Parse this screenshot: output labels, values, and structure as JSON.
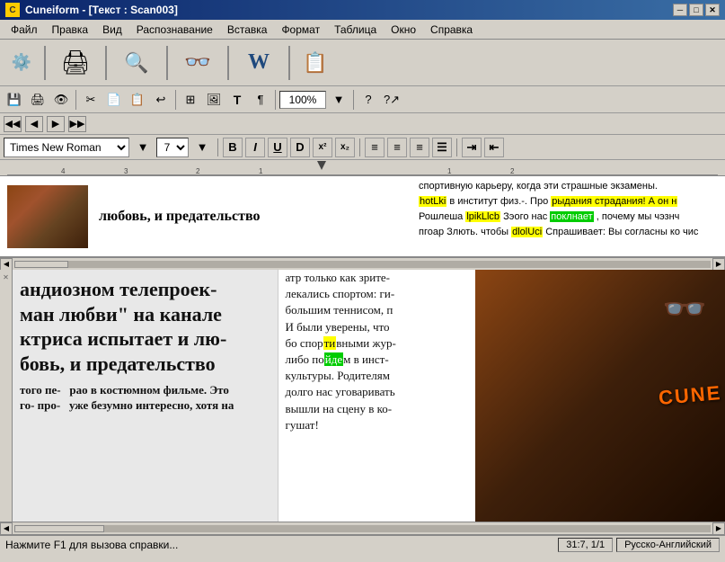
{
  "titleBar": {
    "icon": "C",
    "title": "Cuneiform - [Текст : Scan003]",
    "minBtn": "─",
    "maxBtn": "□",
    "closeBtn": "✕"
  },
  "menuBar": {
    "items": [
      "Файл",
      "Правка",
      "Вид",
      "Распознавание",
      "Вставка",
      "Формат",
      "Таблица",
      "Окно",
      "Справка"
    ]
  },
  "toolbar": {
    "buttons": [
      "🔧",
      "📄",
      "🖨",
      "🔍",
      "📖",
      "W",
      "📋"
    ]
  },
  "toolbar2": {
    "saveIcon": "💾",
    "printIcon": "🖨",
    "zoom": "100%"
  },
  "navBar": {
    "prevFirst": "◀◀",
    "prev": "◀",
    "next": "▶",
    "nextLast": "▶▶"
  },
  "formatBar": {
    "font": "Times New Roman",
    "size": "7",
    "bold": "B",
    "italic": "I",
    "underline": "U",
    "strikethrough": "D",
    "superscript": "x²",
    "subscript": "x₂",
    "alignLeft": "≡",
    "alignCenter": "≡",
    "alignRight": "≡",
    "justify": "≡",
    "indent": "⇤",
    "outdent": "⇥"
  },
  "previewText": {
    "mainText": "любовь, и предательство",
    "rightCol": {
      "line1": "спортивную карьеру, когда эти страшные экзамены.",
      "line2": "hotLki в институт физ.-. Про рыдания страдания! А он н",
      "line3": "Рошлеша lpikLlcb Зэого нас поклнает, почему мы чэзнч",
      "line4": "пгоар Злють. чтобы dlolUci Спрашивает: Вы согласны ко чис"
    }
  },
  "mainContent": {
    "leftColumn": {
      "text": "андиозном телепроек-\nман любви\" на канале\nктриса испытает и лю-\nбовь, и предательство"
    },
    "middleColumn": {
      "text": "атр только как зрите-\nлекались спортом: ги-\nбольшим теннисом, п\nИ были уверены, что\nбо спортивными жур-\nлибо пойдем в инст-\nкультуры. Родителям\nдолго нас уговаривать\nвышли на сцену в ко-\nгушат!"
    },
    "bottomLeftText": "того пе-  рао в костюмном фильме. Это\nго- про-  уже безумно интересно, хотя на",
    "photoText": "CUNE"
  },
  "statusBar": {
    "message": "Нажмите F1 для вызова справки...",
    "position": "31:7, 1/1",
    "language": "Русско-Английский"
  }
}
